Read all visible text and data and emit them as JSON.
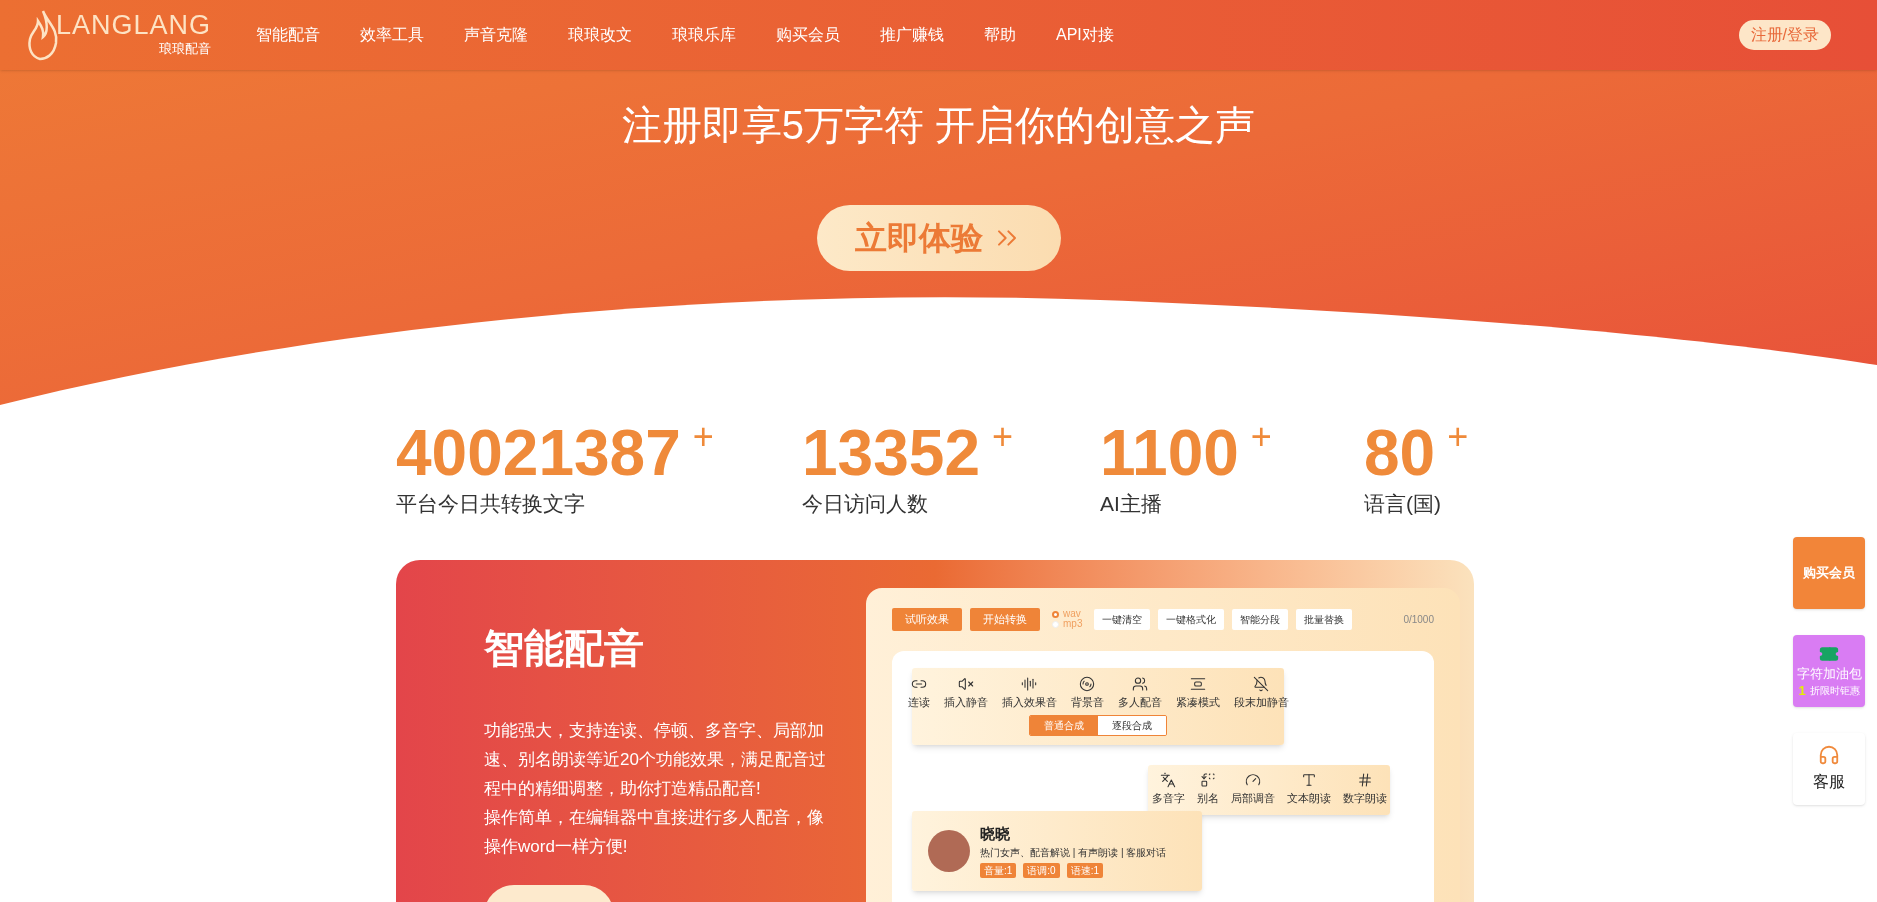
{
  "logo": {
    "wordmark": "LANGLANG",
    "subtitle": "琅琅配音"
  },
  "nav": {
    "items": [
      {
        "label": "智能配音"
      },
      {
        "label": "效率工具"
      },
      {
        "label": "声音克隆"
      },
      {
        "label": "琅琅改文"
      },
      {
        "label": "琅琅乐库"
      },
      {
        "label": "购买会员"
      },
      {
        "label": "推广赚钱"
      },
      {
        "label": "帮助"
      },
      {
        "label": "API对接"
      }
    ],
    "login": "注册/登录"
  },
  "hero": {
    "title": "注册即享5万字符 开启你的创意之声",
    "cta": "立即体验"
  },
  "stats": [
    {
      "value": "40021387",
      "suffix": "+",
      "label": "平台今日共转换文字"
    },
    {
      "value": "13352",
      "suffix": "+",
      "label": "今日访问人数"
    },
    {
      "value": "1100",
      "suffix": "+",
      "label": "AI主播"
    },
    {
      "value": "80",
      "suffix": "+",
      "label": "语言(国)"
    }
  ],
  "feature": {
    "title": "智能配音",
    "paragraphs": [
      "功能强大，支持连读、停顿、多音字、局部加速、别名朗读等近20个功能效果，满足配音过程中的精细调整，助你打造精品配音!",
      "操作简单，在编辑器中直接进行多人配音，像操作word一样方便!"
    ]
  },
  "editor": {
    "actions": [
      "试听效果",
      "开始转换"
    ],
    "formats": [
      {
        "label": "wav",
        "selected": true
      },
      {
        "label": "mp3",
        "selected": false
      }
    ],
    "tools": [
      "一键清空",
      "一键格式化",
      "智能分段",
      "批量替换"
    ],
    "counter": "0/1000",
    "toolbar_1": [
      {
        "label": "连读",
        "kind": "link"
      },
      {
        "label": "插入静音",
        "kind": "pause"
      },
      {
        "label": "插入效果音",
        "kind": "effect"
      },
      {
        "label": "背景音",
        "kind": "music"
      },
      {
        "label": "多人配音",
        "kind": "people"
      },
      {
        "label": "紧凑模式",
        "kind": "compact"
      },
      {
        "label": "段末加静音",
        "kind": "mute"
      }
    ],
    "modes": [
      {
        "label": "普通合成",
        "selected": true
      },
      {
        "label": "逐段合成",
        "selected": false
      }
    ],
    "toolbar_2": [
      {
        "label": "多音字",
        "kind": "poly"
      },
      {
        "label": "别名",
        "kind": "alias"
      },
      {
        "label": "局部调音",
        "kind": "gauge"
      },
      {
        "label": "文本朗读",
        "kind": "text"
      },
      {
        "label": "数字朗读",
        "kind": "number"
      }
    ],
    "voice": {
      "name": "晓晓",
      "tags": "热门女声、配音解说 | 有声朗读 | 客服对话",
      "badges": [
        "音量:1",
        "语调:0",
        "语速:1"
      ]
    }
  },
  "side": {
    "member": "购买会员",
    "pack": {
      "title": "字符加油包",
      "digit": "1",
      "promo": "折限时钜惠"
    },
    "service": "客服"
  }
}
